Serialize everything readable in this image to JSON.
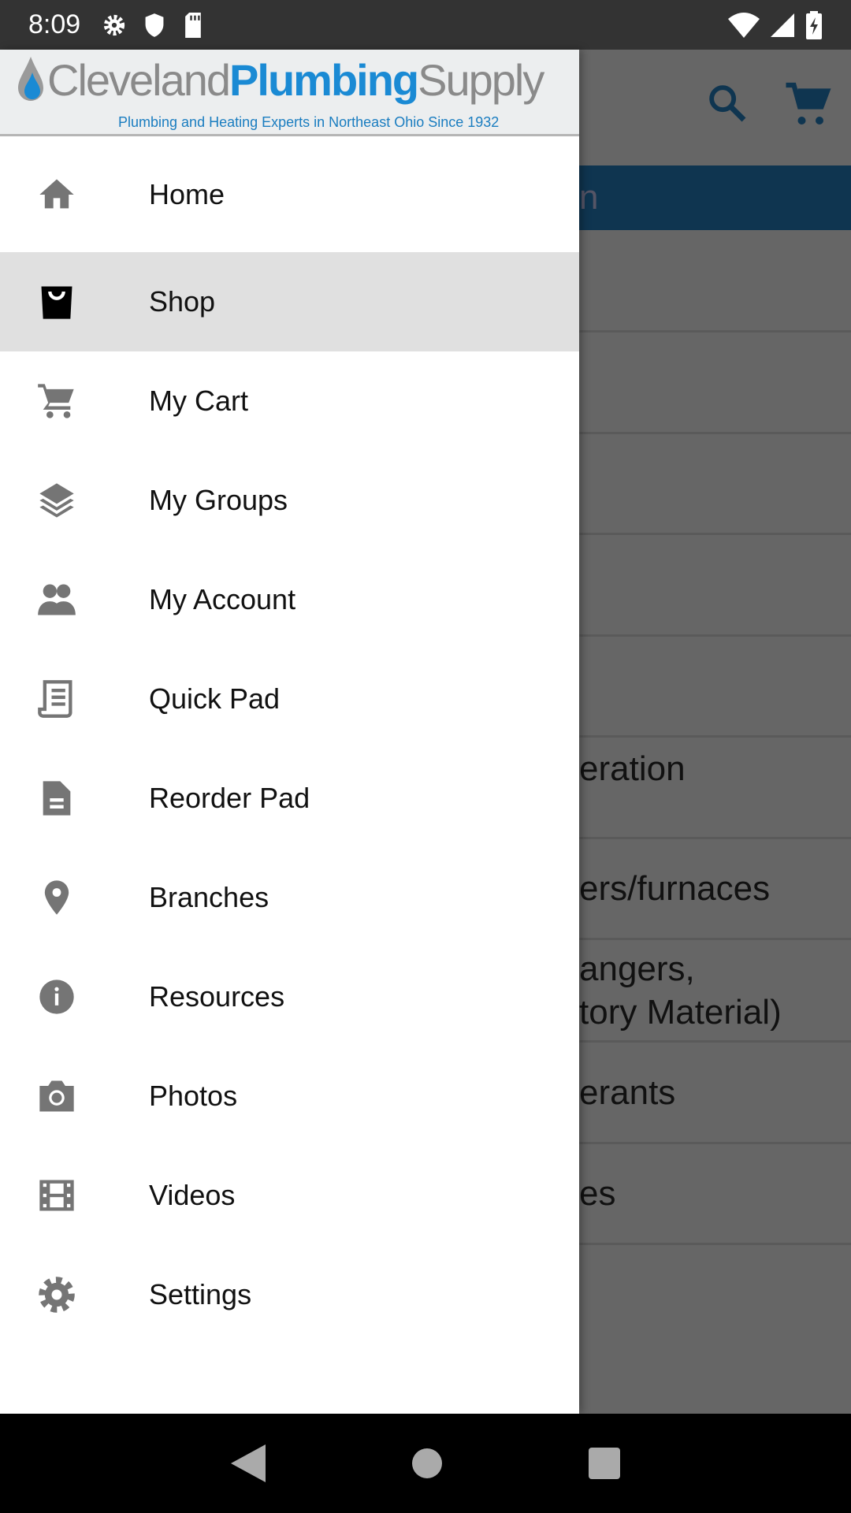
{
  "status_bar": {
    "time": "8:09",
    "icons": [
      "settings-icon",
      "shield-icon",
      "sd-card-icon"
    ],
    "right_icons": [
      "wifi-icon",
      "signal-icon",
      "battery-charging-icon"
    ]
  },
  "logo": {
    "word1": "Cleveland",
    "word2": "Plumbing",
    "word3": "Supply",
    "tagline": "Plumbing and Heating Experts in Northeast Ohio Since 1932"
  },
  "menu": [
    {
      "label": "Home",
      "icon": "home-icon"
    },
    {
      "label": "Shop",
      "icon": "shopping-bag-icon",
      "selected": true
    },
    {
      "label": "My Cart",
      "icon": "cart-icon"
    },
    {
      "label": "My Groups",
      "icon": "layers-icon"
    },
    {
      "label": "My Account",
      "icon": "people-icon"
    },
    {
      "label": "Quick Pad",
      "icon": "receipt-icon"
    },
    {
      "label": "Reorder Pad",
      "icon": "document-icon"
    },
    {
      "label": "Branches",
      "icon": "location-pin-icon"
    },
    {
      "label": "Resources",
      "icon": "info-icon"
    },
    {
      "label": "Photos",
      "icon": "camera-icon"
    },
    {
      "label": "Videos",
      "icon": "film-icon"
    },
    {
      "label": "Settings",
      "icon": "gear-icon"
    }
  ],
  "background": {
    "band_fragment": "n",
    "rows": [
      "",
      "",
      "",
      "",
      "",
      "eration",
      "ers/furnaces",
      "angers,\ntory Material)",
      "erants",
      "es"
    ]
  },
  "colors": {
    "accent": "#1a8ad4",
    "band": "#0f3550"
  }
}
